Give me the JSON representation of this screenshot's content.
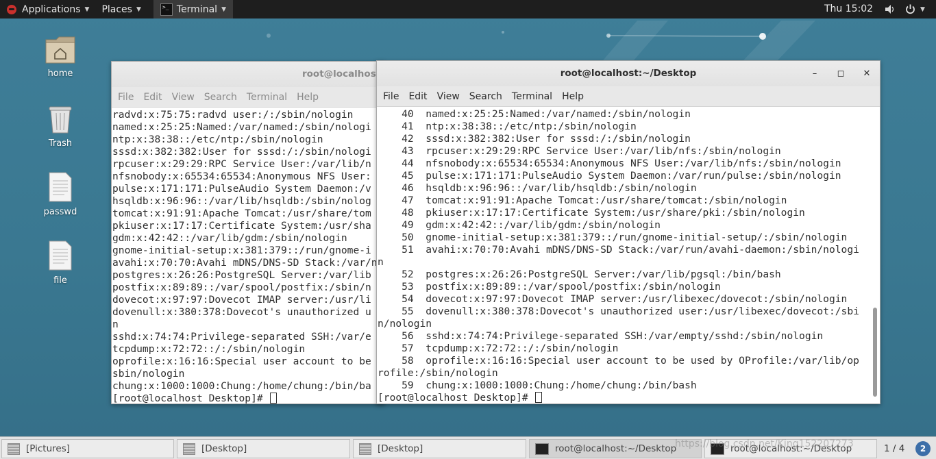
{
  "topbar": {
    "applications": "Applications",
    "places": "Places",
    "terminal": "Terminal",
    "clock": "Thu 15:02"
  },
  "desktop_icons": [
    {
      "label": "home",
      "icon": "home-folder-icon"
    },
    {
      "label": "Trash",
      "icon": "trash-icon"
    },
    {
      "label": "passwd",
      "icon": "text-file-icon"
    },
    {
      "label": "file",
      "icon": "text-file-icon"
    }
  ],
  "back_window": {
    "title": "root@localhost:",
    "menu": [
      "File",
      "Edit",
      "View",
      "Search",
      "Terminal",
      "Help"
    ],
    "lines": [
      "radvd:x:75:75:radvd user:/:/sbin/nologin",
      "named:x:25:25:Named:/var/named:/sbin/nologi",
      "ntp:x:38:38::/etc/ntp:/sbin/nologin",
      "sssd:x:382:382:User for sssd:/:/sbin/nologi",
      "rpcuser:x:29:29:RPC Service User:/var/lib/n",
      "nfsnobody:x:65534:65534:Anonymous NFS User:",
      "pulse:x:171:171:PulseAudio System Daemon:/v",
      "hsqldb:x:96:96::/var/lib/hsqldb:/sbin/nolog",
      "tomcat:x:91:91:Apache Tomcat:/usr/share/tom",
      "pkiuser:x:17:17:Certificate System:/usr/sha",
      "gdm:x:42:42::/var/lib/gdm:/sbin/nologin",
      "gnome-initial-setup:x:381:379::/run/gnome-i",
      "avahi:x:70:70:Avahi mDNS/DNS-SD Stack:/var/n",
      "postgres:x:26:26:PostgreSQL Server:/var/lib",
      "postfix:x:89:89::/var/spool/postfix:/sbin/n",
      "dovecot:x:97:97:Dovecot IMAP server:/usr/li",
      "dovenull:x:380:378:Dovecot's unauthorized u",
      "n",
      "sshd:x:74:74:Privilege-separated SSH:/var/e",
      "tcpdump:x:72:72::/:/sbin/nologin",
      "oprofile:x:16:16:Special user account to be",
      "sbin/nologin",
      "chung:x:1000:1000:Chung:/home/chung:/bin/ba"
    ],
    "prompt": "[root@localhost Desktop]# "
  },
  "front_window": {
    "title": "root@localhost:~/Desktop",
    "menu": [
      "File",
      "Edit",
      "View",
      "Search",
      "Terminal",
      "Help"
    ],
    "lines": [
      "    40  named:x:25:25:Named:/var/named:/sbin/nologin",
      "    41  ntp:x:38:38::/etc/ntp:/sbin/nologin",
      "    42  sssd:x:382:382:User for sssd:/:/sbin/nologin",
      "    43  rpcuser:x:29:29:RPC Service User:/var/lib/nfs:/sbin/nologin",
      "    44  nfsnobody:x:65534:65534:Anonymous NFS User:/var/lib/nfs:/sbin/nologin",
      "    45  pulse:x:171:171:PulseAudio System Daemon:/var/run/pulse:/sbin/nologin",
      "    46  hsqldb:x:96:96::/var/lib/hsqldb:/sbin/nologin",
      "    47  tomcat:x:91:91:Apache Tomcat:/usr/share/tomcat:/sbin/nologin",
      "    48  pkiuser:x:17:17:Certificate System:/usr/share/pki:/sbin/nologin",
      "    49  gdm:x:42:42::/var/lib/gdm:/sbin/nologin",
      "    50  gnome-initial-setup:x:381:379::/run/gnome-initial-setup/:/sbin/nologin",
      "    51  avahi:x:70:70:Avahi mDNS/DNS-SD Stack:/var/run/avahi-daemon:/sbin/nologi",
      "n",
      "    52  postgres:x:26:26:PostgreSQL Server:/var/lib/pgsql:/bin/bash",
      "    53  postfix:x:89:89::/var/spool/postfix:/sbin/nologin",
      "    54  dovecot:x:97:97:Dovecot IMAP server:/usr/libexec/dovecot:/sbin/nologin",
      "    55  dovenull:x:380:378:Dovecot's unauthorized user:/usr/libexec/dovecot:/sbi",
      "n/nologin",
      "    56  sshd:x:74:74:Privilege-separated SSH:/var/empty/sshd:/sbin/nologin",
      "    57  tcpdump:x:72:72::/:/sbin/nologin",
      "    58  oprofile:x:16:16:Special user account to be used by OProfile:/var/lib/op",
      "rofile:/sbin/nologin",
      "    59  chung:x:1000:1000:Chung:/home/chung:/bin/bash"
    ],
    "prompt": "[root@localhost Desktop]# ",
    "controls": {
      "minimize": "–",
      "maximize": "◻",
      "close": "✕"
    }
  },
  "taskbar": {
    "tasks": [
      "[Pictures]",
      "[Desktop]",
      "[Desktop]",
      "root@localhost:~/Desktop",
      "root@localhost:~/Desktop"
    ],
    "pager": "1 / 4",
    "help": "2",
    "watermark": "https://blog.csdn.net/King152207273"
  }
}
